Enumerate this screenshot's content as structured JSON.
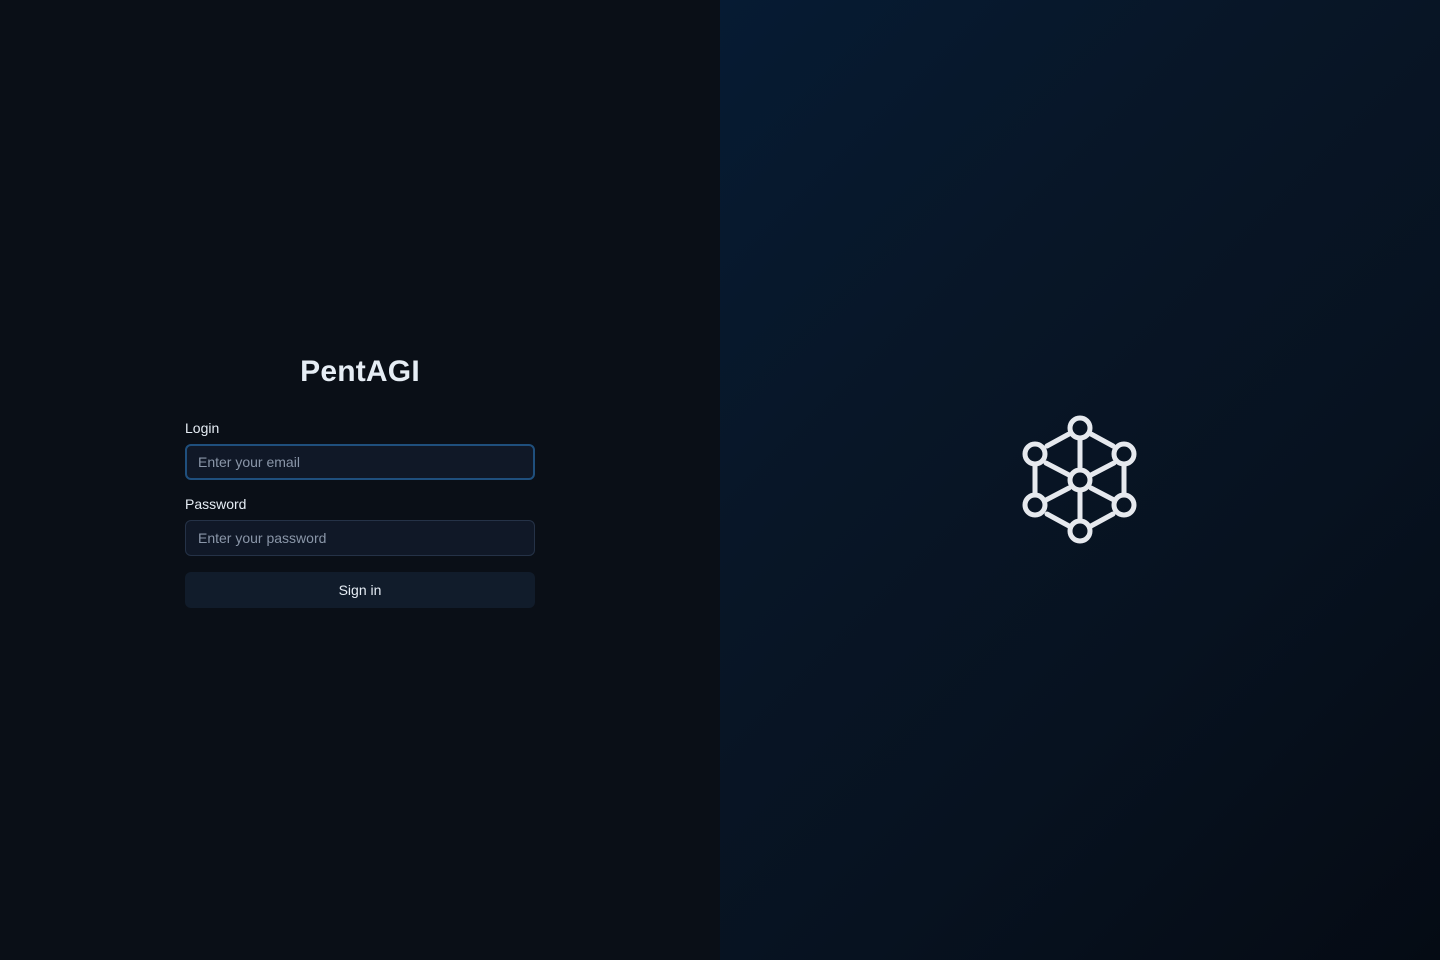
{
  "app": {
    "title": "PentAGI"
  },
  "form": {
    "login_label": "Login",
    "login_placeholder": "Enter your email",
    "password_label": "Password",
    "password_placeholder": "Enter your password",
    "submit_label": "Sign in"
  },
  "brand": {
    "logo_icon": "network-graph-icon",
    "accent_color": "#1f4f7d",
    "logo_color": "#e6e9ee"
  }
}
